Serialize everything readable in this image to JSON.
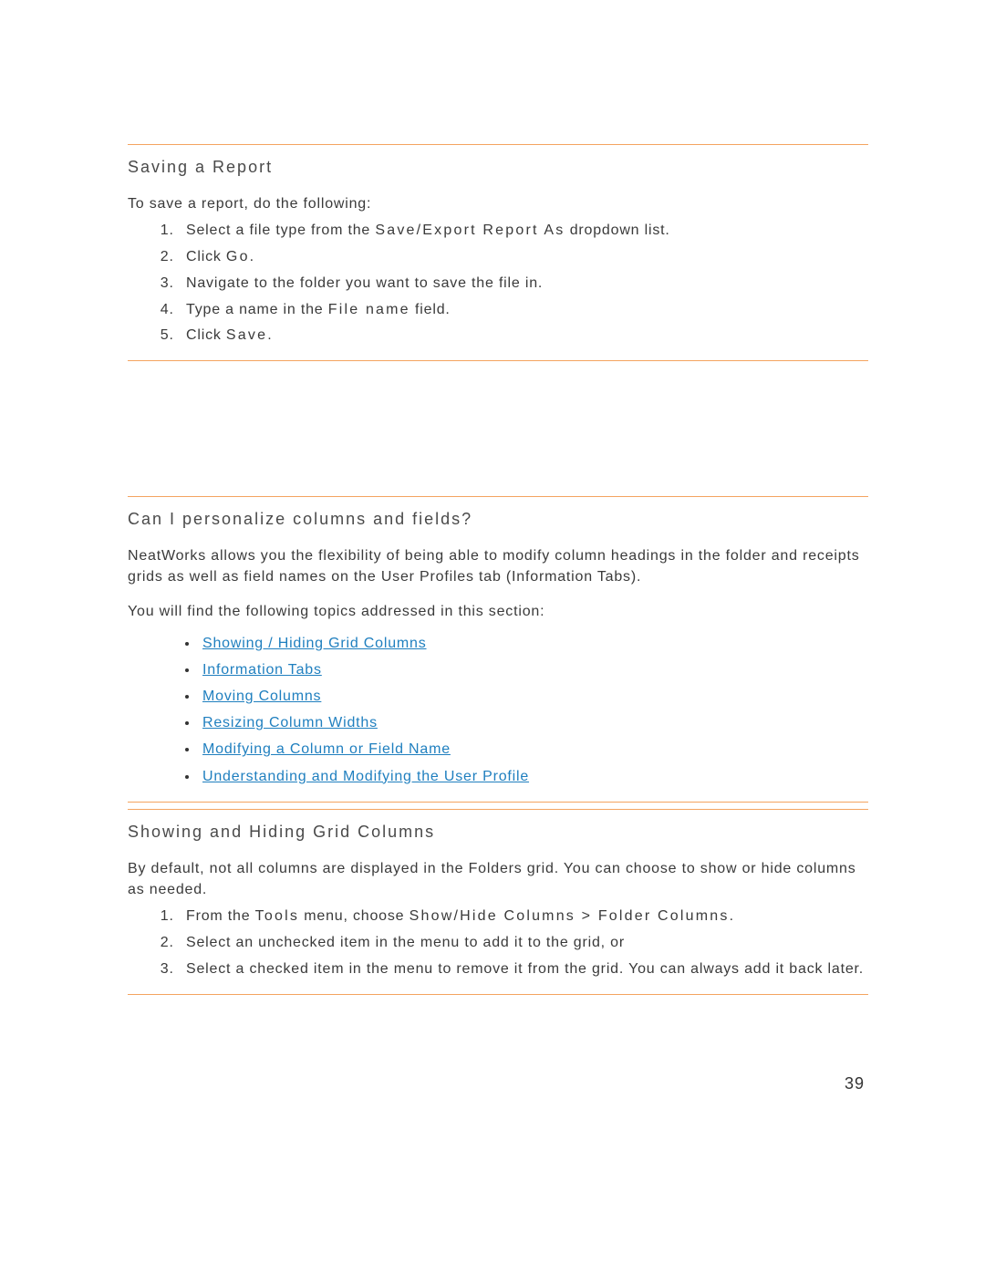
{
  "page_number": "39",
  "section1": {
    "heading": "Saving a Report",
    "intro": "To save a report, do the following:",
    "steps": {
      "s1_pre": "Select a file type from the ",
      "s1_term": "Save/Export Report As",
      "s1_post": " dropdown list.",
      "s2_pre": "Click ",
      "s2_term": "Go",
      "s2_post": ".",
      "s3": "Navigate to the folder you want to save the file in.",
      "s4_pre": "Type a name in the ",
      "s4_term": "File name",
      "s4_post": " field.",
      "s5_pre": "Click ",
      "s5_term": "Save",
      "s5_post": "."
    }
  },
  "section2": {
    "heading": "Can I personalize columns and fields?",
    "para1": "NeatWorks allows you the flexibility of being able to modify column headings in the folder and receipts grids as well as field names on the User Profiles tab (Information Tabs).",
    "para2": "You will find the following topics addressed in this section:",
    "links": [
      "Showing / Hiding Grid Columns",
      "Information Tabs",
      "Moving Columns",
      "Resizing Column Widths",
      "Modifying a Column or Field Name",
      "Understanding and Modifying the User Profile"
    ]
  },
  "section3": {
    "heading": "Showing and Hiding Grid Columns",
    "para1": "By default, not all columns are displayed in the Folders grid. You can choose to show or hide columns as needed.",
    "steps": {
      "s1_pre": "From the ",
      "s1_term1": "Tools",
      "s1_mid": " menu, choose ",
      "s1_term2": "Show/Hide Columns > Folder Columns",
      "s1_post": ".",
      "s2": "Select an unchecked item in the menu to add it to the grid, or",
      "s3": "Select a checked item in the menu to remove it from the grid. You can always add it back later."
    }
  }
}
